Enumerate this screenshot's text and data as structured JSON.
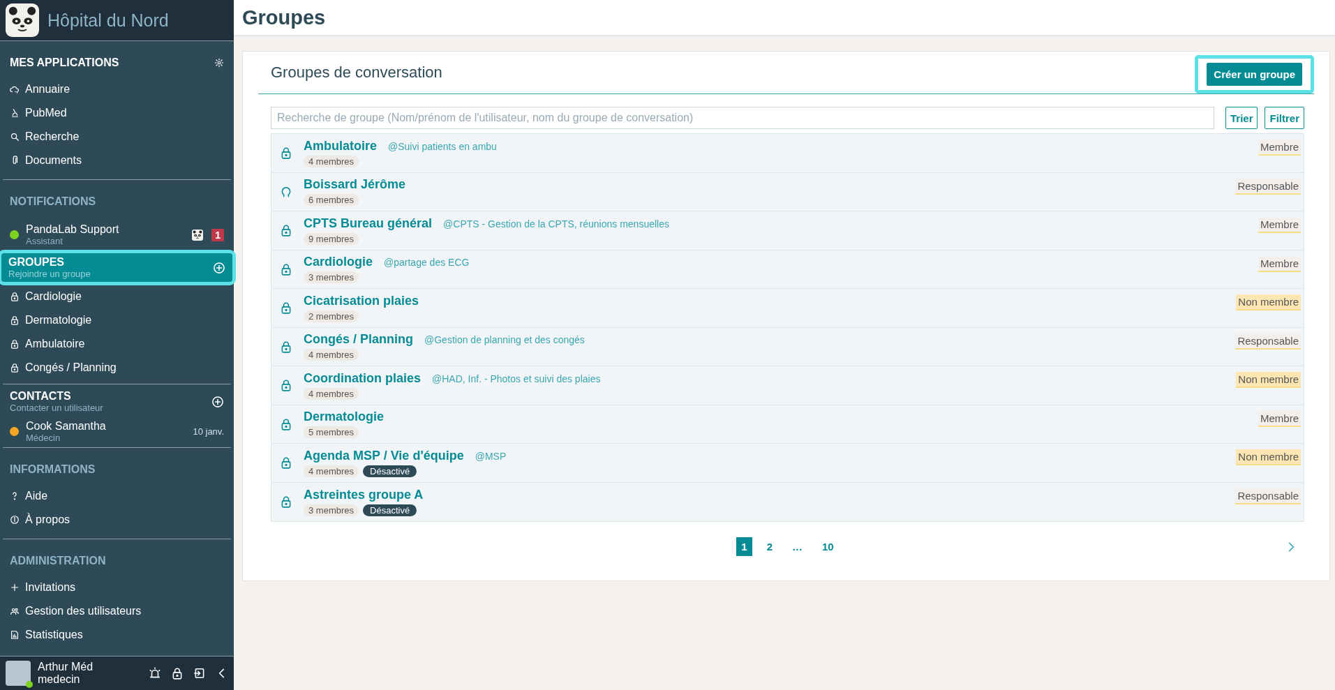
{
  "sidebar": {
    "brand": "Hôpital du Nord",
    "apps": {
      "title": "MES APPLICATIONS",
      "items": [
        "Annuaire",
        "PubMed",
        "Recherche",
        "Documents"
      ]
    },
    "notifications": {
      "title": "NOTIFICATIONS",
      "items": [
        {
          "name": "PandaLab Support",
          "subtitle": "Assistant",
          "color": "#7ed321",
          "badge": "1"
        }
      ]
    },
    "groups": {
      "title": "GROUPES",
      "subtitle": "Rejoindre un groupe",
      "selected": true,
      "highlighted": true,
      "items": [
        "Cardiologie",
        "Dermatologie",
        "Ambulatoire",
        "Congés / Planning"
      ]
    },
    "contacts": {
      "title": "CONTACTS",
      "subtitle": "Contacter un utilisateur",
      "items": [
        {
          "name": "Cook Samantha",
          "subtitle": "Médecin",
          "color": "#f5a623",
          "date": "10 janv."
        }
      ]
    },
    "informations": {
      "title": "INFORMATIONS",
      "items": [
        "Aide",
        "À propos"
      ]
    },
    "administration": {
      "title": "ADMINISTRATION",
      "items": [
        "Invitations",
        "Gestion des utilisateurs",
        "Statistiques"
      ]
    },
    "user": {
      "name": "Arthur Méd",
      "role": "medecin",
      "online": true
    }
  },
  "page_title": "Groupes",
  "card": {
    "title": "Groupes de conversation",
    "create_button": {
      "label": "Créer un groupe",
      "highlighted": true
    },
    "search": {
      "placeholder": "Recherche de groupe (Nom/prénom de l'utilisateur, nom du groupe de conversation)"
    },
    "sort_button": "Trier",
    "filter_button": "Filtrer",
    "rows": [
      {
        "kind": "group",
        "name": "Ambulatoire",
        "description": "@Suivi patients en ambu",
        "members": "4 membres",
        "role": "Membre",
        "role_highlighted": false
      },
      {
        "kind": "person",
        "name": "Boissard Jérôme",
        "members": "6 membres",
        "role": "Responsable",
        "role_highlighted": false
      },
      {
        "kind": "group",
        "name": "CPTS Bureau général",
        "description": "@CPTS - Gestion de la CPTS, réunions mensuelles",
        "members": "9 membres",
        "role": "Membre",
        "role_highlighted": false
      },
      {
        "kind": "group",
        "name": "Cardiologie",
        "description": "@partage des ECG",
        "members": "3 membres",
        "role": "Membre",
        "role_highlighted": false
      },
      {
        "kind": "group",
        "name": "Cicatrisation plaies",
        "members": "2 membres",
        "role": "Non membre",
        "role_highlighted": true
      },
      {
        "kind": "group",
        "name": "Congés / Planning",
        "description": "@Gestion de planning et des congés",
        "members": "4 membres",
        "role": "Responsable",
        "role_highlighted": false
      },
      {
        "kind": "group",
        "name": "Coordination plaies",
        "description": "@HAD, Inf. - Photos et suivi des plaies",
        "members": "4 membres",
        "role": "Non membre",
        "role_highlighted": true
      },
      {
        "kind": "group",
        "name": "Dermatologie",
        "members": "5 membres",
        "role": "Membre",
        "role_highlighted": false
      },
      {
        "kind": "group",
        "name": "Agenda MSP / Vie d'équipe",
        "description": "@MSP",
        "members": "4 membres",
        "status": "Désactivé",
        "role": "Non membre",
        "role_highlighted": true
      },
      {
        "kind": "group",
        "name": "Astreintes groupe A",
        "members": "3 membres",
        "status": "Désactivé",
        "role": "Responsable",
        "role_highlighted": false
      }
    ],
    "pagination": {
      "pages": [
        {
          "label": "1",
          "selected": true
        },
        {
          "label": "2",
          "selected": false
        },
        {
          "label": "…",
          "selected": false
        },
        {
          "label": "10",
          "selected": false
        }
      ]
    }
  }
}
